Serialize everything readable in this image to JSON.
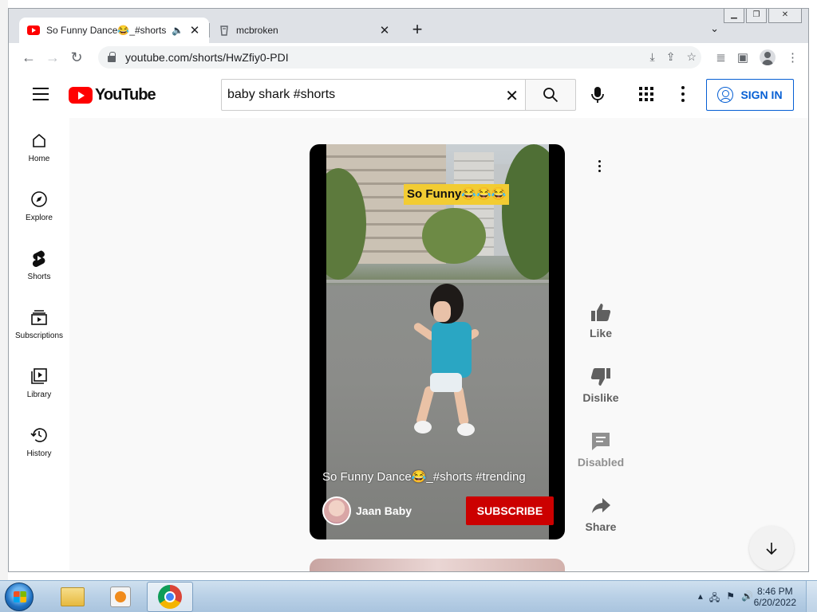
{
  "browser": {
    "tabs": [
      {
        "title": "So Funny Dance😂_#shorts #trending",
        "active": true
      },
      {
        "title": "mcbroken",
        "active": false
      }
    ],
    "url": "youtube.com/shorts/HwZfiy0-PDI"
  },
  "youtube": {
    "logo_text": "YouTube",
    "search_value": "baby shark #shorts",
    "sign_in_label": "SIGN IN",
    "guide": [
      {
        "icon": "home-icon",
        "label": "Home"
      },
      {
        "icon": "explore-icon",
        "label": "Explore"
      },
      {
        "icon": "shorts-icon",
        "label": "Shorts"
      },
      {
        "icon": "subscriptions-icon",
        "label": "Subscriptions"
      },
      {
        "icon": "library-icon",
        "label": "Library"
      },
      {
        "icon": "history-icon",
        "label": "History"
      }
    ],
    "short": {
      "sticker_text": "So Funny😂😂😂",
      "title": "So Funny Dance😂_#shorts #trending",
      "channel": "Jaan Baby",
      "subscribe_label": "SUBSCRIBE"
    },
    "actions": [
      {
        "icon": "thumbs-up-icon",
        "label": "Like"
      },
      {
        "icon": "thumbs-down-icon",
        "label": "Dislike"
      },
      {
        "icon": "comment-icon",
        "label": "Disabled"
      },
      {
        "icon": "share-icon",
        "label": "Share"
      }
    ]
  },
  "taskbar": {
    "time": "8:46 PM",
    "date": "6/20/2022"
  },
  "colors": {
    "youtube_red": "#ff0000",
    "subscribe_red": "#cc0000",
    "signin_blue": "#065fd4"
  }
}
